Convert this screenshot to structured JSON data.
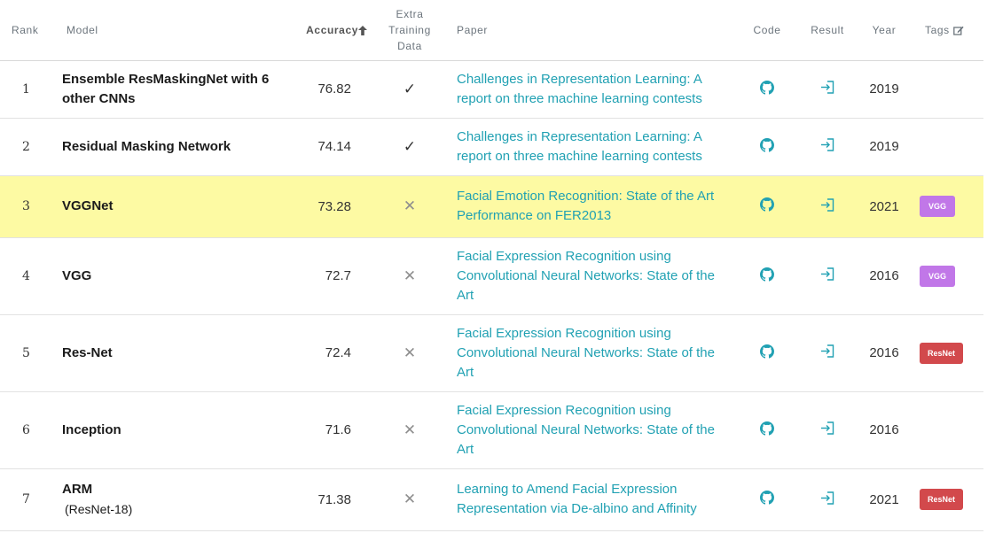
{
  "headers": {
    "rank": "Rank",
    "model": "Model",
    "accuracy": "Accuracy",
    "extra_line1": "Extra",
    "extra_line2": "Training",
    "extra_line3": "Data",
    "paper": "Paper",
    "code": "Code",
    "result": "Result",
    "year": "Year",
    "tags": "Tags"
  },
  "colors": {
    "link": "#21a1b3",
    "highlight_row": "#fdfaa3",
    "vgg_tag": "#c177e8",
    "resnet_tag": "#d2494c"
  },
  "icons": {
    "sort": "arrow-up-icon",
    "edit": "edit-icon",
    "code": "github-icon",
    "result": "result-link-icon",
    "check": "checkmark-icon",
    "cross": "cross-icon"
  },
  "rows": [
    {
      "rank": "1",
      "model": "Ensemble ResMaskingNet with 6 other CNNs",
      "model_sub": "",
      "accuracy": "76.82",
      "extra": "✓",
      "paper": "Challenges in Representation Learning: A report on three machine learning contests",
      "year": "2019",
      "tag": ""
    },
    {
      "rank": "2",
      "model": "Residual Masking Network",
      "model_sub": "",
      "accuracy": "74.14",
      "extra": "✓",
      "paper": "Challenges in Representation Learning: A report on three machine learning contests",
      "year": "2019",
      "tag": ""
    },
    {
      "rank": "3",
      "model": "VGGNet",
      "model_sub": "",
      "accuracy": "73.28",
      "extra": "✕",
      "paper": "Facial Emotion Recognition: State of the Art Performance on FER2013",
      "year": "2021",
      "tag": "VGG"
    },
    {
      "rank": "4",
      "model": "VGG",
      "model_sub": "",
      "accuracy": "72.7",
      "extra": "✕",
      "paper": "Facial Expression Recognition using Convolutional Neural Networks: State of the Art",
      "year": "2016",
      "tag": "VGG"
    },
    {
      "rank": "5",
      "model": "Res-Net",
      "model_sub": "",
      "accuracy": "72.4",
      "extra": "✕",
      "paper": "Facial Expression Recognition using Convolutional Neural Networks: State of the Art",
      "year": "2016",
      "tag": "ResNet"
    },
    {
      "rank": "6",
      "model": "Inception",
      "model_sub": "",
      "accuracy": "71.6",
      "extra": "✕",
      "paper": "Facial Expression Recognition using Convolutional Neural Networks: State of the Art",
      "year": "2016",
      "tag": ""
    },
    {
      "rank": "7",
      "model": "ARM",
      "model_sub": "(ResNet-18)",
      "accuracy": "71.38",
      "extra": "✕",
      "paper": "Learning to Amend Facial Expression Representation via De-albino and Affinity",
      "year": "2021",
      "tag": "ResNet"
    }
  ]
}
